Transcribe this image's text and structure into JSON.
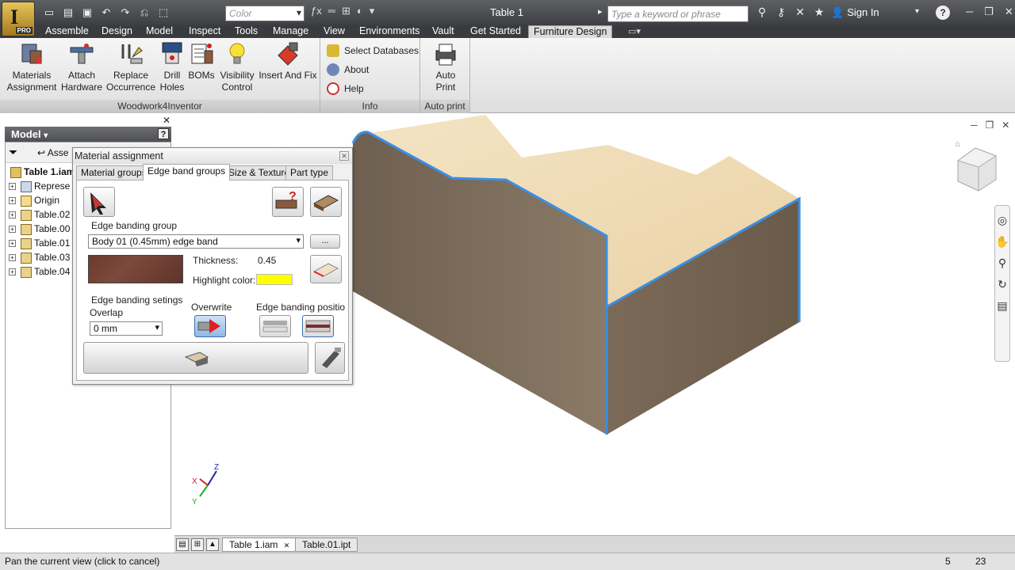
{
  "title_bar": {
    "window_title": "Table 1",
    "color_placeholder": "Color",
    "search_placeholder": "Type a keyword or phrase",
    "sign_in": "Sign In",
    "app_badge": "PRO"
  },
  "ribbon_tabs": [
    "Assemble",
    "Design",
    "Model",
    "Inspect",
    "Tools",
    "Manage",
    "View",
    "Environments",
    "Vault",
    "Get Started",
    "Furniture Design"
  ],
  "active_tab": "Furniture Design",
  "ribbon": {
    "woodwork_panel": {
      "title": "Woodwork4Inventor",
      "buttons": [
        {
          "line1": "Materials",
          "line2": "Assignment"
        },
        {
          "line1": "Attach",
          "line2": "Hardware"
        },
        {
          "line1": "Replace",
          "line2": "Occurrence"
        },
        {
          "line1": "Drill",
          "line2": "Holes"
        },
        {
          "line1": "BOMs",
          "line2": ""
        },
        {
          "line1": "Visibility",
          "line2": "Control"
        },
        {
          "line1": "Insert And Fix",
          "line2": ""
        }
      ]
    },
    "info_panel": {
      "title": "Info",
      "items": [
        "Select Databases",
        "About",
        "Help"
      ]
    },
    "autoprint_panel": {
      "title": "Auto print",
      "button": {
        "line1": "Auto",
        "line2": "Print"
      }
    }
  },
  "model_browser": {
    "header": "Model",
    "filter_label": "Asse",
    "tree": [
      {
        "label": "Table 1.iam",
        "root": true
      },
      {
        "label": "Represe"
      },
      {
        "label": "Origin"
      },
      {
        "label": "Table.02"
      },
      {
        "label": "Table.00"
      },
      {
        "label": "Table.01"
      },
      {
        "label": "Table.03"
      },
      {
        "label": "Table.04"
      }
    ]
  },
  "dialog": {
    "title": "Material assignment",
    "tabs": [
      "Material groups",
      "Edge band groups",
      "Size & Texture",
      "Part type"
    ],
    "active_tab": "Edge band groups",
    "edge_banding_group_label": "Edge banding group",
    "edge_banding_group_value": "Body 01 (0.45mm) edge band",
    "browse_label": "...",
    "thickness_label": "Thickness:",
    "thickness_value": "0.45",
    "highlight_label": "Highlight color:",
    "highlight_color": "#ffff00",
    "settings_label": "Edge banding setings",
    "overlap_label": "Overlap",
    "overlap_value": "0 mm",
    "overwrite_label": "Overwrite",
    "position_label": "Edge  banding positio"
  },
  "doc_tabs": [
    "Table 1.iam",
    "Table.01.ipt"
  ],
  "active_doc": "Table 1.iam",
  "status_bar": {
    "message": "Pan the current view (click to cancel)",
    "count1": "5",
    "count2": "23"
  },
  "colors": {
    "edge_highlight": "#3a8ee6",
    "wood_top": "#f0dcb4",
    "wood_side": "#7a6a58",
    "title_bar": "#4a4b4e"
  }
}
